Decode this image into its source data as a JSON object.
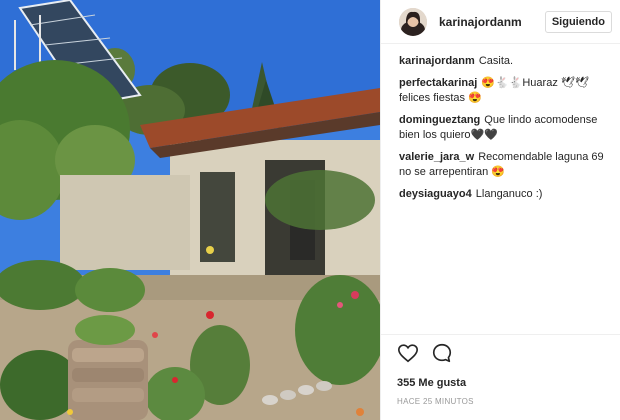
{
  "post": {
    "username": "karinajordanm",
    "follow_label": "Siguiendo",
    "caption_user": "karinajordanm",
    "caption_text": "Casita.",
    "comments": [
      {
        "user": "perfectakarinaj",
        "text": "😍🐇🐇Huaraz 🕊🕊 felices fiestas 😍"
      },
      {
        "user": "domingueztang",
        "text": "Que lindo acomodense bien los quiero🖤🖤"
      },
      {
        "user": "valerie_jara_w",
        "text": "Recomendable laguna 69 no se arrepentiran 😍"
      },
      {
        "user": "deysiaguayo4",
        "text": "Llanganuco :)"
      }
    ],
    "likes": "355 Me gusta",
    "timestamp": "HACE 25 MINUTOS"
  },
  "icons": {
    "like": "heart-icon",
    "comment": "comment-icon"
  }
}
